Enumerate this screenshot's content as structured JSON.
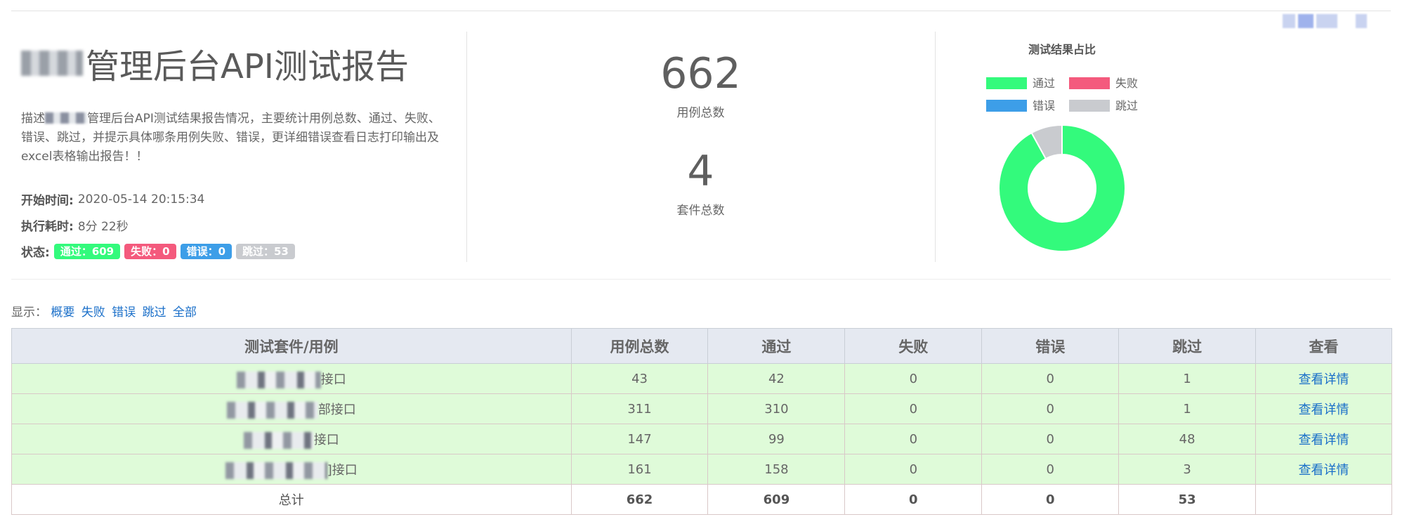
{
  "header": {
    "title": "管理后台API测试报告",
    "desc_prefix": "描述",
    "desc_text": "管理后台API测试结果报告情况，主要统计用例总数、通过、失败、错误、跳过，并提示具体哪条用例失败、错误，更详细错误查看日志打印输出及excel表格输出报告！！",
    "start_label": "开始时间:",
    "start_value": "2020-05-14 20:15:34",
    "duration_label": "执行耗时:",
    "duration_value": "8分 22秒",
    "status_label": "状态:",
    "badges": {
      "pass": "通过：609",
      "fail": "失败：0",
      "error": "错误：0",
      "skip": "跳过：53"
    }
  },
  "summary": {
    "total_cases": "662",
    "total_cases_label": "用例总数",
    "total_suites": "4",
    "total_suites_label": "套件总数"
  },
  "chart_data": {
    "type": "pie",
    "title": "测试结果占比",
    "legend_position": "top",
    "series": [
      {
        "name": "通过",
        "value": 609,
        "color": "#33fa7c"
      },
      {
        "name": "失败",
        "value": 0,
        "color": "#f45a7d"
      },
      {
        "name": "错误",
        "value": 0,
        "color": "#3d9ee8"
      },
      {
        "name": "跳过",
        "value": 53,
        "color": "#c9cbcf"
      }
    ]
  },
  "filter": {
    "label": "显示：",
    "options": [
      "概要",
      "失败",
      "错误",
      "跳过",
      "全部"
    ]
  },
  "table": {
    "headers": [
      "测试套件/用例",
      "用例总数",
      "通过",
      "失败",
      "错误",
      "跳过",
      "查看"
    ],
    "rows": [
      {
        "name": "接口",
        "total": "43",
        "pass": "42",
        "fail": "0",
        "error": "0",
        "skip": "1",
        "action": "查看详情"
      },
      {
        "name": "部接口",
        "total": "311",
        "pass": "310",
        "fail": "0",
        "error": "0",
        "skip": "1",
        "action": "查看详情"
      },
      {
        "name": "接口",
        "total": "147",
        "pass": "99",
        "fail": "0",
        "error": "0",
        "skip": "48",
        "action": "查看详情"
      },
      {
        "name": "]接口",
        "total": "161",
        "pass": "158",
        "fail": "0",
        "error": "0",
        "skip": "3",
        "action": "查看详情"
      }
    ],
    "total_row": {
      "label": "总计",
      "total": "662",
      "pass": "609",
      "fail": "0",
      "error": "0",
      "skip": "53"
    }
  },
  "colors": {
    "pass": "#33fa7c",
    "fail": "#f45a7d",
    "error": "#3d9ee8",
    "skip": "#c9cbcf",
    "link": "#1a6fc9"
  }
}
